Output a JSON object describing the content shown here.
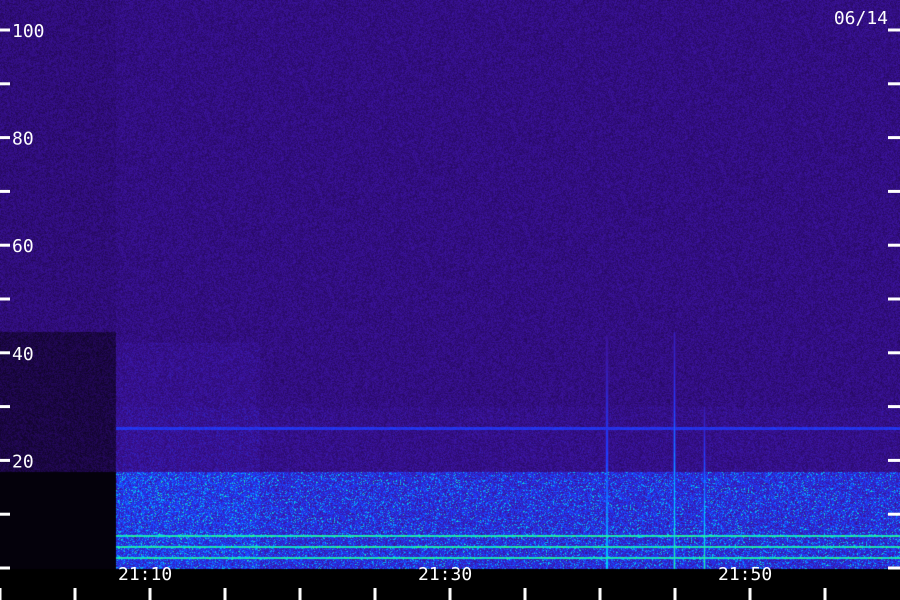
{
  "chart_data": {
    "type": "heatmap",
    "title": "",
    "xlabel": "",
    "ylabel": "",
    "date_label": "06/14",
    "y_tick_labels": [
      "100",
      "80",
      "60",
      "40",
      "20"
    ],
    "y_tick_values": [
      100,
      80,
      60,
      40,
      20
    ],
    "ylim": [
      0,
      100
    ],
    "x_tick_labels": [
      "21:10",
      "21:30",
      "21:50"
    ],
    "x_tick_values": [
      "21:10",
      "21:30",
      "21:50"
    ],
    "xlim": [
      "21:10",
      "21:59"
    ],
    "data_start": "21:10",
    "minor_tick_minutes": 5,
    "grid": false,
    "colormap": [
      "#000000",
      "#2a0a6a",
      "#3c14a0",
      "#1e3cff",
      "#00c8ff",
      "#3cff64"
    ],
    "features": {
      "band_levels": [
        0,
        18
      ],
      "horizontal_line_levels": [
        2,
        4,
        6,
        26
      ],
      "vertical_bursts": [
        {
          "time": "21:41:30",
          "top": 43
        },
        {
          "time": "21:46:00",
          "top": 44
        },
        {
          "time": "21:48:00",
          "top": 30
        }
      ]
    }
  }
}
